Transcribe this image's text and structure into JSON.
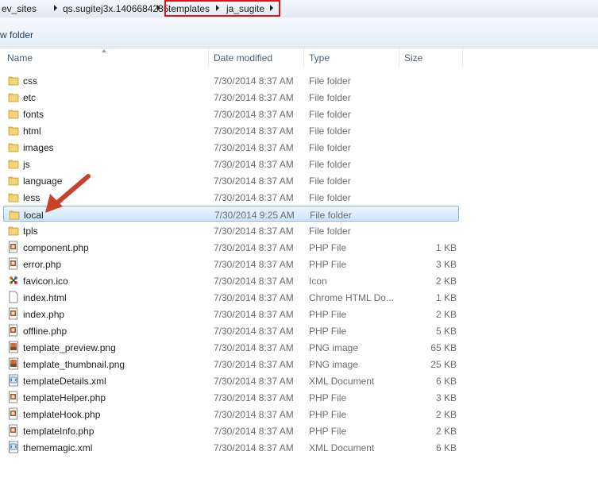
{
  "address_bar": {
    "crumbs": [
      "ev_sites",
      "qs.sugitej3x.1406684235",
      "templates",
      "ja_sugite"
    ]
  },
  "toolbar": {
    "new_folder_label": "w folder"
  },
  "columns": {
    "name": "Name",
    "date": "Date modified",
    "type": "Type",
    "size": "Size"
  },
  "files": [
    {
      "name": "css",
      "date": "7/30/2014 8:37 AM",
      "type": "File folder",
      "size": "",
      "icon": "folder-icon"
    },
    {
      "name": "etc",
      "date": "7/30/2014 8:37 AM",
      "type": "File folder",
      "size": "",
      "icon": "folder-icon"
    },
    {
      "name": "fonts",
      "date": "7/30/2014 8:37 AM",
      "type": "File folder",
      "size": "",
      "icon": "folder-icon"
    },
    {
      "name": "html",
      "date": "7/30/2014 8:37 AM",
      "type": "File folder",
      "size": "",
      "icon": "folder-icon"
    },
    {
      "name": "images",
      "date": "7/30/2014 8:37 AM",
      "type": "File folder",
      "size": "",
      "icon": "folder-icon"
    },
    {
      "name": "js",
      "date": "7/30/2014 8:37 AM",
      "type": "File folder",
      "size": "",
      "icon": "folder-icon"
    },
    {
      "name": "language",
      "date": "7/30/2014 8:37 AM",
      "type": "File folder",
      "size": "",
      "icon": "folder-icon"
    },
    {
      "name": "less",
      "date": "7/30/2014 8:37 AM",
      "type": "File folder",
      "size": "",
      "icon": "folder-icon"
    },
    {
      "name": "local",
      "date": "7/30/2014 9:25 AM",
      "type": "File folder",
      "size": "",
      "icon": "folder-icon",
      "selected": true
    },
    {
      "name": "tpls",
      "date": "7/30/2014 8:37 AM",
      "type": "File folder",
      "size": "",
      "icon": "folder-icon"
    },
    {
      "name": "component.php",
      "date": "7/30/2014 8:37 AM",
      "type": "PHP File",
      "size": "1 KB",
      "icon": "php-file-icon"
    },
    {
      "name": "error.php",
      "date": "7/30/2014 8:37 AM",
      "type": "PHP File",
      "size": "3 KB",
      "icon": "php-file-icon"
    },
    {
      "name": "favicon.ico",
      "date": "7/30/2014 8:37 AM",
      "type": "Icon",
      "size": "2 KB",
      "icon": "joomla-icon"
    },
    {
      "name": "index.html",
      "date": "7/30/2014 8:37 AM",
      "type": "Chrome HTML Do...",
      "size": "1 KB",
      "icon": "blank-file-icon"
    },
    {
      "name": "index.php",
      "date": "7/30/2014 8:37 AM",
      "type": "PHP File",
      "size": "2 KB",
      "icon": "php-file-icon"
    },
    {
      "name": "offline.php",
      "date": "7/30/2014 8:37 AM",
      "type": "PHP File",
      "size": "5 KB",
      "icon": "php-file-icon"
    },
    {
      "name": "template_preview.png",
      "date": "7/30/2014 8:37 AM",
      "type": "PNG image",
      "size": "65 KB",
      "icon": "image-file-icon"
    },
    {
      "name": "template_thumbnail.png",
      "date": "7/30/2014 8:37 AM",
      "type": "PNG image",
      "size": "25 KB",
      "icon": "image-file-icon"
    },
    {
      "name": "templateDetails.xml",
      "date": "7/30/2014 8:37 AM",
      "type": "XML Document",
      "size": "6 KB",
      "icon": "xml-file-icon"
    },
    {
      "name": "templateHelper.php",
      "date": "7/30/2014 8:37 AM",
      "type": "PHP File",
      "size": "3 KB",
      "icon": "php-file-icon"
    },
    {
      "name": "templateHook.php",
      "date": "7/30/2014 8:37 AM",
      "type": "PHP File",
      "size": "2 KB",
      "icon": "php-file-icon"
    },
    {
      "name": "templateInfo.php",
      "date": "7/30/2014 8:37 AM",
      "type": "PHP File",
      "size": "2 KB",
      "icon": "php-file-icon"
    },
    {
      "name": "thememagic.xml",
      "date": "7/30/2014 8:37 AM",
      "type": "XML Document",
      "size": "6 KB",
      "icon": "xml-file-icon"
    }
  ],
  "colors": {
    "annotation_red": "#e0141b",
    "arrow_red": "#c8432a",
    "selection": "#cfe5fb",
    "folder": "#e8c15a"
  }
}
